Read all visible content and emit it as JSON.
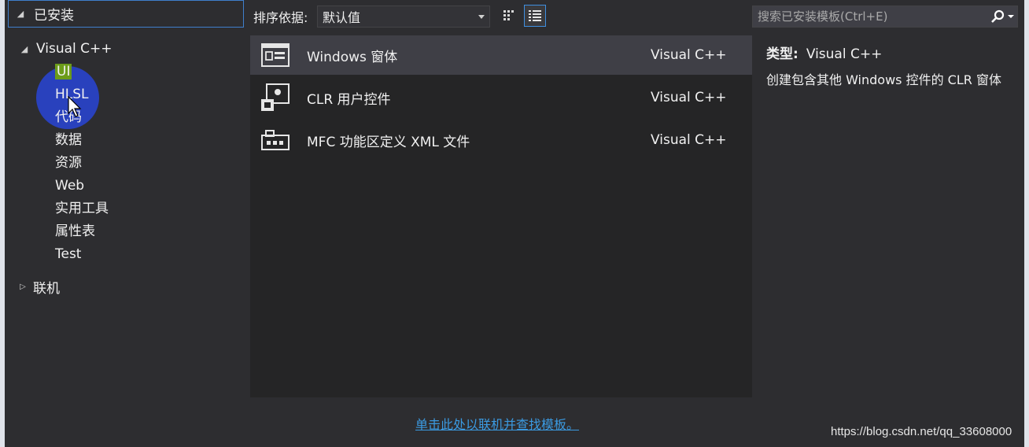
{
  "left_panel": {
    "installed_label": "已安装",
    "root_node": "Visual C++",
    "items": [
      "UI",
      "HLSL",
      "代码",
      "数据",
      "资源",
      "Web",
      "实用工具",
      "属性表",
      "Test"
    ],
    "selected_item": "UI",
    "online_label": "联机"
  },
  "toolbar": {
    "sort_label": "排序依据:",
    "sort_value": "默认值",
    "search_placeholder": "搜索已安装模板(Ctrl+E)"
  },
  "templates": [
    {
      "name": "Windows 窗体",
      "language": "Visual C++",
      "icon": "windows-form-icon",
      "selected": true
    },
    {
      "name": "CLR 用户控件",
      "language": "Visual C++",
      "icon": "user-control-icon",
      "selected": false
    },
    {
      "name": "MFC 功能区定义 XML 文件",
      "language": "Visual C++",
      "icon": "ribbon-xml-icon",
      "selected": false
    }
  ],
  "details": {
    "type_label": "类型:",
    "type_value": "Visual C++",
    "description": "创建包含其他 Windows 控件的 CLR 窗体"
  },
  "online_link": "单击此处以联机并查找模板。",
  "watermark": "https://blog.csdn.net/qq_33608000",
  "colors": {
    "panel_bg": "#2d2d30",
    "list_bg": "#252526",
    "selected_row": "#3f3f46",
    "accent_blue": "#3f7fcc",
    "link": "#3b9ae1",
    "selected_tree_item": "#6c9c1a",
    "cursor_highlight": "#2846e6"
  }
}
